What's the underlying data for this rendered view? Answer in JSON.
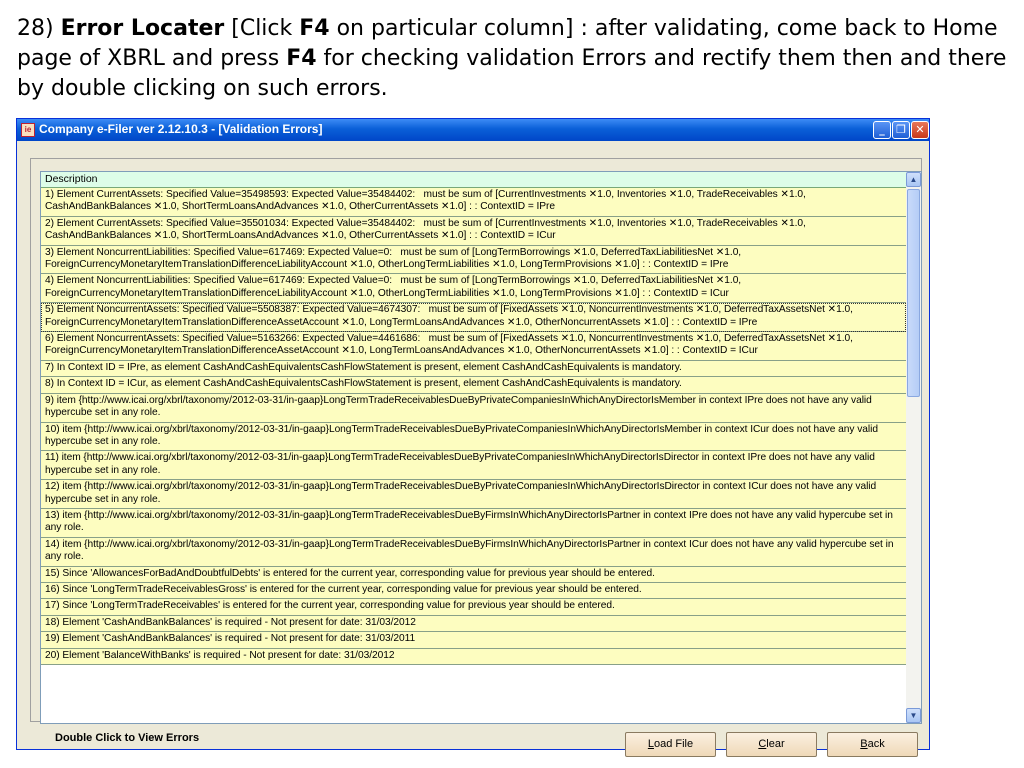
{
  "caption": {
    "line1_prefix": "28) ",
    "title": "Error Locater",
    "line1_mid": "  [Click ",
    "key1": "F4",
    "line1_rest": " on particular column] : after validating, come back to Home page of XBRL and press ",
    "key2": "F4",
    "line1_end": " for checking validation Errors and rectify them then and there by double clicking on such errors."
  },
  "window": {
    "title": "Company e-Filer ver 2.12.10.3 - [Validation Errors]",
    "icon_label": "ie",
    "minimize_glyph": "_",
    "restore_glyph": "❐",
    "close_glyph": "✕"
  },
  "list": {
    "header": "Description",
    "rows": [
      "1) Element CurrentAssets: Specified Value=35498593: Expected Value=35484402:   must be sum of [CurrentInvestments ✕1.0, Inventories ✕1.0, TradeReceivables ✕1.0, CashAndBankBalances ✕1.0, ShortTermLoansAndAdvances ✕1.0, OtherCurrentAssets ✕1.0] : : ContextID = IPre",
      "2) Element CurrentAssets: Specified Value=35501034: Expected Value=35484402:   must be sum of [CurrentInvestments ✕1.0, Inventories ✕1.0, TradeReceivables ✕1.0, CashAndBankBalances ✕1.0, ShortTermLoansAndAdvances ✕1.0, OtherCurrentAssets ✕1.0] : : ContextID = ICur",
      "3) Element NoncurrentLiabilities: Specified Value=617469: Expected Value=0:   must be sum of [LongTermBorrowings ✕1.0, DeferredTaxLiabilitiesNet ✕1.0, ForeignCurrencyMonetaryItemTranslationDifferenceLiabilityAccount ✕1.0, OtherLongTermLiabilities ✕1.0, LongTermProvisions ✕1.0] : : ContextID = IPre",
      "4) Element NoncurrentLiabilities: Specified Value=617469: Expected Value=0:   must be sum of [LongTermBorrowings ✕1.0, DeferredTaxLiabilitiesNet ✕1.0, ForeignCurrencyMonetaryItemTranslationDifferenceLiabilityAccount ✕1.0, OtherLongTermLiabilities ✕1.0, LongTermProvisions ✕1.0] : : ContextID = ICur",
      "5) Element NoncurrentAssets: Specified Value=5508387: Expected Value=4674307:   must be sum of [FixedAssets ✕1.0, NoncurrentInvestments ✕1.0, DeferredTaxAssetsNet ✕1.0, ForeignCurrencyMonetaryItemTranslationDifferenceAssetAccount ✕1.0, LongTermLoansAndAdvances ✕1.0, OtherNoncurrentAssets ✕1.0] : : ContextID = IPre",
      "6) Element NoncurrentAssets: Specified Value=5163266: Expected Value=4461686:   must be sum of [FixedAssets ✕1.0, NoncurrentInvestments ✕1.0, DeferredTaxAssetsNet ✕1.0, ForeignCurrencyMonetaryItemTranslationDifferenceAssetAccount ✕1.0, LongTermLoansAndAdvances ✕1.0, OtherNoncurrentAssets ✕1.0] : : ContextID = ICur",
      "7) In Context ID = IPre, as element CashAndCashEquivalentsCashFlowStatement is present, element CashAndCashEquivalents is mandatory.",
      "8) In Context ID = ICur, as element CashAndCashEquivalentsCashFlowStatement is present, element CashAndCashEquivalents is mandatory.",
      "9) item {http://www.icai.org/xbrl/taxonomy/2012-03-31/in-gaap}LongTermTradeReceivablesDueByPrivateCompaniesInWhichAnyDirectorIsMember in context IPre does not have any valid hypercube set in any role.",
      "10) item {http://www.icai.org/xbrl/taxonomy/2012-03-31/in-gaap}LongTermTradeReceivablesDueByPrivateCompaniesInWhichAnyDirectorIsMember in context ICur does not have any valid hypercube set in any role.",
      "11) item {http://www.icai.org/xbrl/taxonomy/2012-03-31/in-gaap}LongTermTradeReceivablesDueByPrivateCompaniesInWhichAnyDirectorIsDirector in context IPre does not have any valid hypercube set in any role.",
      "12) item {http://www.icai.org/xbrl/taxonomy/2012-03-31/in-gaap}LongTermTradeReceivablesDueByPrivateCompaniesInWhichAnyDirectorIsDirector in context ICur does not have any valid hypercube set in any role.",
      "13) item {http://www.icai.org/xbrl/taxonomy/2012-03-31/in-gaap}LongTermTradeReceivablesDueByFirmsInWhichAnyDirectorIsPartner in context IPre does not have any valid hypercube set in any role.",
      "14) item {http://www.icai.org/xbrl/taxonomy/2012-03-31/in-gaap}LongTermTradeReceivablesDueByFirmsInWhichAnyDirectorIsPartner in context ICur does not have any valid hypercube set in any role.",
      "15) Since 'AllowancesForBadAndDoubtfulDebts' is entered for the current year, corresponding value for previous year should be entered.",
      "16) Since 'LongTermTradeReceivablesGross' is entered for the current year, corresponding value for previous year should be entered.",
      "17) Since 'LongTermTradeReceivables' is entered for the current year, corresponding value for previous year should be entered.",
      "18) Element 'CashAndBankBalances' is required - Not present for date: 31/03/2012",
      "19) Element 'CashAndBankBalances' is required - Not present for date: 31/03/2011",
      "20) Element 'BalanceWithBanks' is required - Not present for date: 31/03/2012"
    ],
    "selected_index": 4
  },
  "scrollbar": {
    "up_glyph": "▲",
    "down_glyph": "▼",
    "position_fraction": 0.0
  },
  "footer": {
    "hint": "Double Click to View Errors",
    "load_accel": "L",
    "load_rest": "oad File",
    "clear_accel": "C",
    "clear_rest": "lear",
    "back_accel": "B",
    "back_rest": "ack"
  }
}
